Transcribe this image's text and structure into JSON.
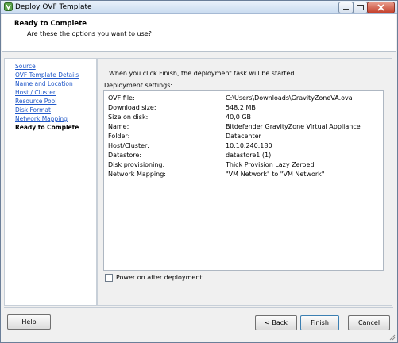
{
  "window": {
    "title": "Deploy OVF Template"
  },
  "header": {
    "title": "Ready to Complete",
    "subtitle": "Are these the options you want to use?"
  },
  "nav": {
    "items": [
      {
        "label": "Source"
      },
      {
        "label": "OVF Template Details"
      },
      {
        "label": "Name and Location"
      },
      {
        "label": "Host / Cluster"
      },
      {
        "label": "Resource Pool"
      },
      {
        "label": "Disk Format"
      },
      {
        "label": "Network Mapping"
      },
      {
        "label": "Ready to Complete"
      }
    ]
  },
  "main": {
    "intro": "When you click Finish, the deployment task will be started.",
    "settings_label": "Deployment settings:",
    "settings": [
      {
        "key": "OVF file:",
        "value": "C:\\Users\\Downloads\\GravityZoneVA.ova"
      },
      {
        "key": "Download size:",
        "value": "548,2 MB"
      },
      {
        "key": "Size on disk:",
        "value": "40,0 GB"
      },
      {
        "key": "Name:",
        "value": "Bitdefender GravityZone Virtual Appliance"
      },
      {
        "key": "Folder:",
        "value": "Datacenter"
      },
      {
        "key": "Host/Cluster:",
        "value": "10.10.240.180"
      },
      {
        "key": "Datastore:",
        "value": "datastore1 (1)"
      },
      {
        "key": "Disk provisioning:",
        "value": "Thick Provision Lazy Zeroed"
      },
      {
        "key": "Network Mapping:",
        "value": "\"VM Network\" to \"VM Network\""
      }
    ],
    "power_on": {
      "label": "Power on after deployment",
      "checked": false
    }
  },
  "buttons": {
    "help": "Help",
    "back": "< Back",
    "finish": "Finish",
    "cancel": "Cancel"
  },
  "colors": {
    "link": "#1f57c9",
    "titlebar": "#c9dbef",
    "close": "#c4402c"
  }
}
